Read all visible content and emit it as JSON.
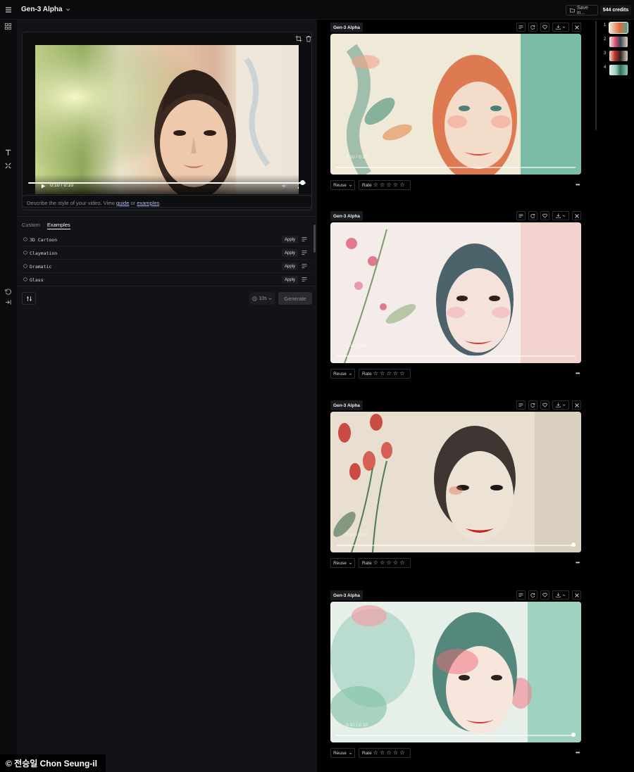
{
  "app": {
    "model_selector": "Gen-3 Alpha",
    "save_label": "Save in...",
    "credits": "544 credits"
  },
  "preview": {
    "time": "0:10 / 0:10"
  },
  "prompt": {
    "text_before": "Describe the style of your video. View ",
    "guide": "guide",
    "or": " or ",
    "examples": "examples",
    "period": "."
  },
  "tabs": [
    {
      "label": "Custom"
    },
    {
      "label": "Examples"
    }
  ],
  "styles": [
    {
      "name": "3D Cartoon",
      "apply": "Apply"
    },
    {
      "name": "Claymation",
      "apply": "Apply"
    },
    {
      "name": "Dramatic",
      "apply": "Apply"
    },
    {
      "name": "Glass",
      "apply": "Apply"
    }
  ],
  "controls": {
    "duration": "10s",
    "generate": "Generate"
  },
  "cards": [
    {
      "model": "Gen-3 Alpha",
      "time": "0:10 / 0:10",
      "reuse": "Reuse",
      "rate": "Rate",
      "accent": "#e36b3a"
    },
    {
      "model": "Gen-3 Alpha",
      "time": "0:10 / 0:10",
      "reuse": "Reuse",
      "rate": "Rate",
      "accent": "#d84a6a"
    },
    {
      "model": "Gen-3 Alpha",
      "time": "0:10 / 0:10",
      "reuse": "Reuse",
      "rate": "Rate",
      "accent": "#c4302b"
    },
    {
      "model": "Gen-3 Alpha",
      "time": "0:10 / 0:10",
      "reuse": "Reuse",
      "rate": "Rate",
      "accent": "#3fae92"
    }
  ],
  "thumbnails": [
    {
      "num": "1"
    },
    {
      "num": "2"
    },
    {
      "num": "3"
    },
    {
      "num": "4"
    }
  ],
  "watermark": "© 전승일 Chon Seung-il",
  "stars": "☆ ☆ ☆ ☆ ☆"
}
